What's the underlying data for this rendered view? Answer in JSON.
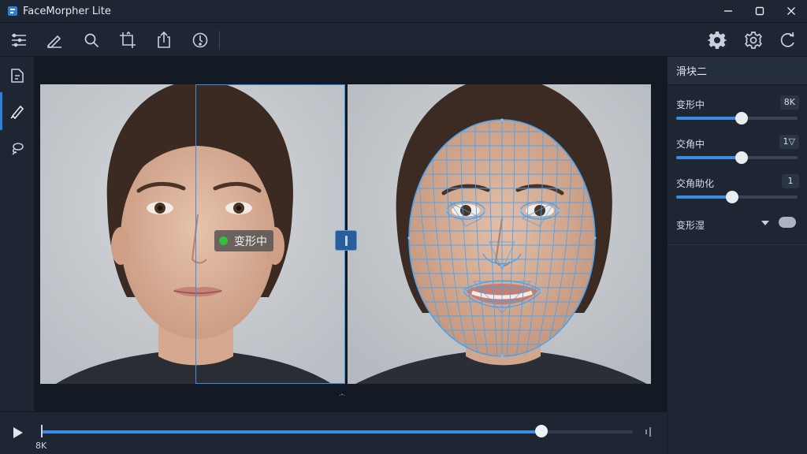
{
  "app": {
    "title": "FaceMorpher Lite"
  },
  "window_controls": [
    "minimize",
    "maximize",
    "close"
  ],
  "toolbar": {
    "left_icons": [
      "menu-icon",
      "edit-icon",
      "search-icon",
      "crop-icon",
      "export-icon",
      "history-icon"
    ],
    "right_icons": [
      "settings-icon",
      "preferences-icon",
      "refresh-icon"
    ]
  },
  "rail": {
    "icons": [
      "file-icon",
      "brush-icon",
      "lasso-icon"
    ],
    "active_index": 1
  },
  "canvas": {
    "morph_label": "变形中",
    "caption": "ᐧᐩᐧ"
  },
  "panel": {
    "title": "滑块二",
    "params": [
      {
        "label": "变形中",
        "value": "8K",
        "fraction": 0.54
      },
      {
        "label": "交角中",
        "value": "1▽",
        "fraction": 0.54
      },
      {
        "label": "交角助化",
        "value": "1",
        "fraction": 0.46
      }
    ],
    "toggle_row": {
      "label": "变形湿",
      "enabled": false
    }
  },
  "timeline": {
    "time_label": "8K",
    "progress": 0.845
  },
  "colors": {
    "accent": "#3c8be0",
    "mesh": "#4aa3f0",
    "bg": "#1b2230"
  }
}
